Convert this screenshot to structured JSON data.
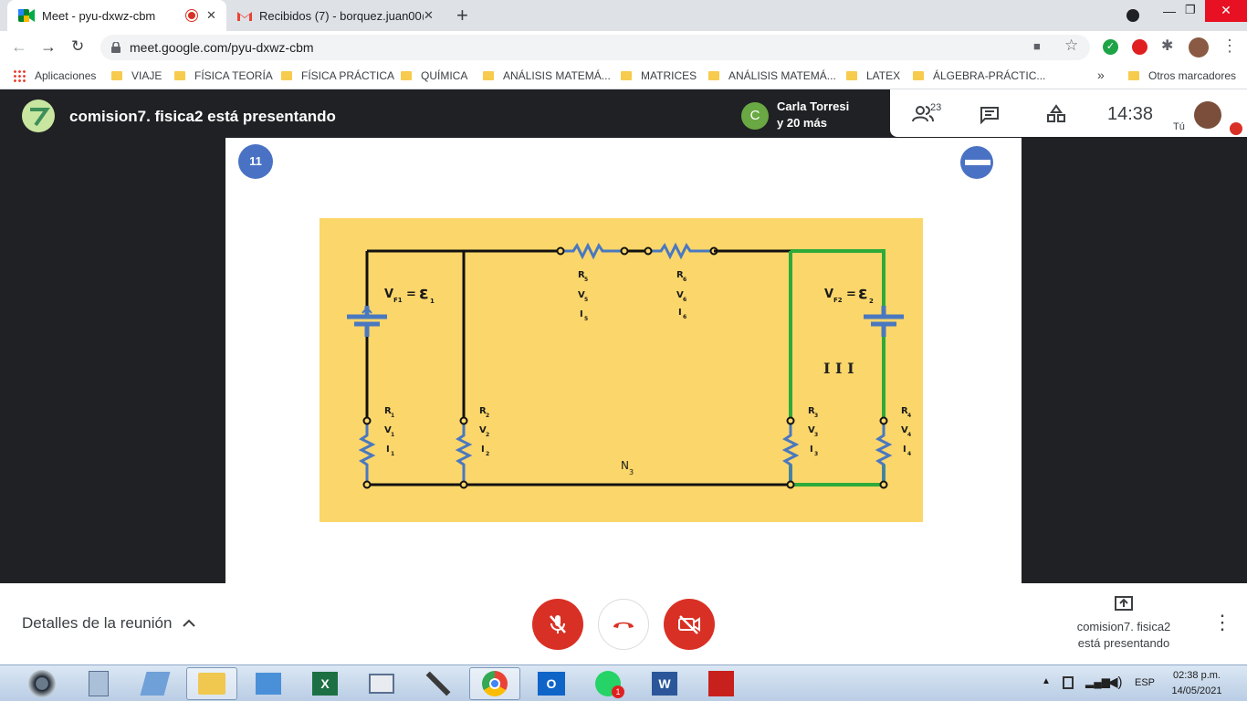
{
  "browser": {
    "tabs": [
      {
        "title": "Meet - pyu-dxwz-cbm",
        "recording": true
      },
      {
        "title": "Recibidos (7) - borquez.juan00@"
      }
    ],
    "new_tab": "+",
    "url": "meet.google.com/pyu-dxwz-cbm",
    "bookmarks": [
      "Aplicaciones",
      "VIAJE",
      "FÍSICA TEORÍA",
      "FÍSICA PRÁCTICA",
      "QUÍMICA",
      "ANÁLISIS MATEMÁ...",
      "MATRICES",
      "ANÁLISIS MATEMÁ...",
      "LATEX",
      "ÁLGEBRA-PRÁCTIC..."
    ],
    "bookmarks_more": "»",
    "other_bookmarks": "Otros marcadores"
  },
  "meet": {
    "presenter_title": "comision7. fisica2 está presentando",
    "participant_initial": "C",
    "participant_name": "Carla Torresi",
    "participant_more": "y 20 más",
    "people_count": "23",
    "clock": "14:38",
    "you_label": "Tú",
    "details_label": "Detalles de la reunión",
    "present_label_line1": "comision7. fisica2",
    "present_label_line2": "está presentando"
  },
  "slide": {
    "page_badge": "11",
    "labels": {
      "vf1": "V",
      "vf1_sub": "F1",
      "eq1": "=",
      "eps1": "ε",
      "eps1_sub": "1",
      "vf2": "V",
      "vf2_sub": "F2",
      "eq2": "=",
      "eps2": "ε",
      "eps2_sub": "2",
      "r5": "R",
      "r5_sub": "5",
      "v5": "V",
      "v5_sub": "5",
      "i5": "I",
      "i5_sub": "5",
      "r6": "R",
      "r6_sub": "6",
      "v6": "V",
      "v6_sub": "6",
      "i6": "I",
      "i6_sub": "6",
      "r1": "R",
      "r1_sub": "1",
      "v1": "V",
      "v1_sub": "1",
      "i1": "I",
      "i1_sub": "1",
      "r2": "R",
      "r2_sub": "2",
      "v2": "V",
      "v2_sub": "2",
      "i2": "I",
      "i2_sub": "2",
      "r3": "R",
      "r3_sub": "3",
      "v3": "V",
      "v3_sub": "3",
      "i3": "I",
      "i3_sub": "3",
      "r4": "R",
      "r4_sub": "4",
      "v4": "V",
      "v4_sub": "4",
      "i4": "I",
      "i4_sub": "4",
      "mesh": "I I I",
      "node": "N",
      "node_sub": "3"
    },
    "colors": {
      "background": "#fbd66a",
      "wire": "#111111",
      "component": "#4a78c0",
      "mesh_highlight": "#2eaa3a"
    }
  },
  "taskbar": {
    "language": "ESP",
    "time": "02:38 p.m.",
    "date": "14/05/2021",
    "whatsapp_badge": "1"
  },
  "colors": {
    "accent": "#1a73e8",
    "danger": "#d93025",
    "meet_bg": "#202124"
  }
}
